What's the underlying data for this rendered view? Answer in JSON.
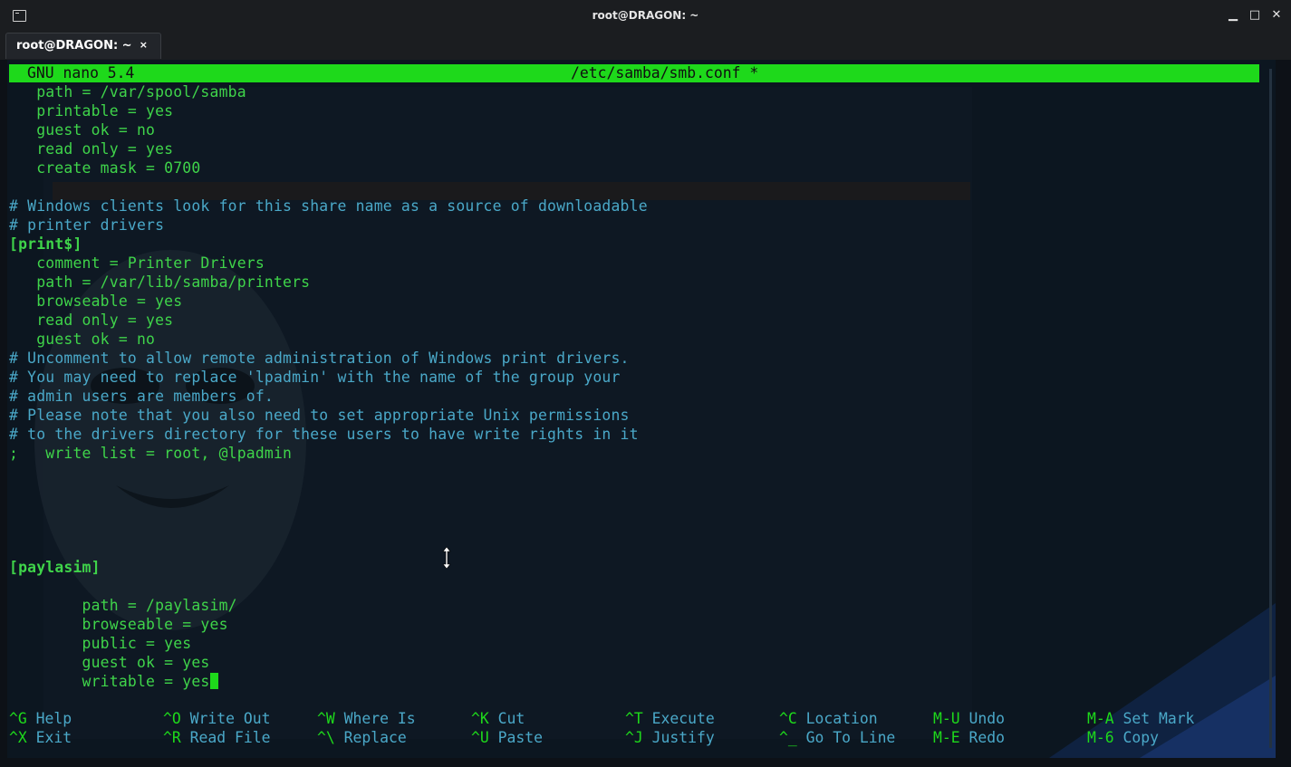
{
  "window": {
    "title": "root@DRAGON: ~"
  },
  "tabs": [
    {
      "label": "root@DRAGON: ~",
      "close": "×"
    }
  ],
  "window_controls": {
    "minimize": "▁",
    "maximize": "□",
    "close": "✕"
  },
  "nano": {
    "version_label": "GNU nano 5.4",
    "file_label": "/etc/samba/smb.conf *"
  },
  "editor_lines": [
    {
      "text": "   path = /var/spool/samba",
      "style": "green"
    },
    {
      "text": "   printable = yes",
      "style": "green"
    },
    {
      "text": "   guest ok = no",
      "style": "green"
    },
    {
      "text": "   read only = yes",
      "style": "green"
    },
    {
      "text": "   create mask = 0700",
      "style": "green"
    },
    {
      "text": "",
      "style": "green"
    },
    {
      "text": "# Windows clients look for this share name as a source of downloadable",
      "style": "cyan"
    },
    {
      "text": "# printer drivers",
      "style": "cyan"
    },
    {
      "text": "[print$]",
      "style": "bold"
    },
    {
      "text": "   comment = Printer Drivers",
      "style": "green"
    },
    {
      "text": "   path = /var/lib/samba/printers",
      "style": "green"
    },
    {
      "text": "   browseable = yes",
      "style": "green"
    },
    {
      "text": "   read only = yes",
      "style": "green"
    },
    {
      "text": "   guest ok = no",
      "style": "green"
    },
    {
      "text": "# Uncomment to allow remote administration of Windows print drivers.",
      "style": "cyan"
    },
    {
      "text": "# You may need to replace 'lpadmin' with the name of the group your",
      "style": "cyan"
    },
    {
      "text": "# admin users are members of.",
      "style": "cyan"
    },
    {
      "text": "# Please note that you also need to set appropriate Unix permissions",
      "style": "cyan"
    },
    {
      "text": "# to the drivers directory for these users to have write rights in it",
      "style": "cyan"
    },
    {
      "text": ";   write list = root, @lpadmin",
      "style": "green"
    },
    {
      "text": "",
      "style": "green"
    },
    {
      "text": "",
      "style": "green"
    },
    {
      "text": "",
      "style": "green"
    },
    {
      "text": "",
      "style": "green"
    },
    {
      "text": "",
      "style": "green"
    },
    {
      "text": "[paylasim]",
      "style": "bold"
    },
    {
      "text": "",
      "style": "green"
    },
    {
      "text": "        path = /paylasim/",
      "style": "green"
    },
    {
      "text": "        browseable = yes",
      "style": "green"
    },
    {
      "text": "        public = yes",
      "style": "green"
    },
    {
      "text": "        guest ok = yes",
      "style": "green"
    },
    {
      "text": "        writable = yes",
      "style": "green"
    }
  ],
  "shortcuts": [
    [
      {
        "key": "^G",
        "label": "Help"
      },
      {
        "key": "^X",
        "label": "Exit"
      }
    ],
    [
      {
        "key": "^O",
        "label": "Write Out"
      },
      {
        "key": "^R",
        "label": "Read File"
      }
    ],
    [
      {
        "key": "^W",
        "label": "Where Is"
      },
      {
        "key": "^\\",
        "label": "Replace"
      }
    ],
    [
      {
        "key": "^K",
        "label": "Cut"
      },
      {
        "key": "^U",
        "label": "Paste"
      }
    ],
    [
      {
        "key": "^T",
        "label": "Execute"
      },
      {
        "key": "^J",
        "label": "Justify"
      }
    ],
    [
      {
        "key": "^C",
        "label": "Location"
      },
      {
        "key": "^_",
        "label": "Go To Line"
      }
    ],
    [
      {
        "key": "M-U",
        "label": "Undo"
      },
      {
        "key": "M-E",
        "label": "Redo"
      }
    ],
    [
      {
        "key": "M-A",
        "label": "Set Mark"
      },
      {
        "key": "M-6",
        "label": "Copy"
      }
    ]
  ],
  "colors": {
    "nano_green": "#1ed91b",
    "text_green": "#3fd44a",
    "comment_cyan": "#4aa8c8",
    "terminal_bg": "#0c1620",
    "chrome_bg": "#1b1d20"
  },
  "icons": {
    "app": "terminal-icon",
    "mouse": "vertical-resize-cursor-icon"
  }
}
